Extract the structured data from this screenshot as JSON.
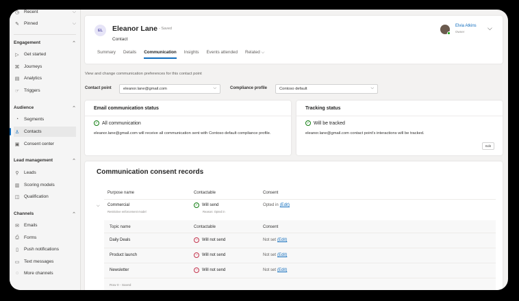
{
  "sidebar": {
    "top": [
      {
        "icon": "clock-icon",
        "label": "Recent"
      },
      {
        "icon": "pin-icon",
        "label": "Pinned"
      }
    ],
    "groups": [
      {
        "title": "Engagement",
        "items": [
          {
            "icon": "play-icon",
            "label": "Get started"
          },
          {
            "icon": "journey-icon",
            "label": "Journeys"
          },
          {
            "icon": "analytics-icon",
            "label": "Analytics"
          },
          {
            "icon": "trigger-icon",
            "label": "Triggers"
          }
        ]
      },
      {
        "title": "Audience",
        "items": [
          {
            "icon": "segment-icon",
            "label": "Segments"
          },
          {
            "icon": "contact-icon",
            "label": "Contacts"
          },
          {
            "icon": "consent-icon",
            "label": "Consent center"
          }
        ]
      },
      {
        "title": "Lead management",
        "items": [
          {
            "icon": "lead-icon",
            "label": "Leads"
          },
          {
            "icon": "scoring-icon",
            "label": "Scoring models"
          },
          {
            "icon": "qualification-icon",
            "label": "Qualification"
          }
        ]
      },
      {
        "title": "Channels",
        "items": [
          {
            "icon": "email-icon",
            "label": "Emails"
          },
          {
            "icon": "form-icon",
            "label": "Forms"
          },
          {
            "icon": "push-icon",
            "label": "Push notifications"
          },
          {
            "icon": "sms-icon",
            "label": "Text messages"
          },
          {
            "icon": "channels-icon",
            "label": "More channels"
          }
        ]
      }
    ],
    "active": "Contacts"
  },
  "record": {
    "initials": "EL",
    "name": "Eleanor Lane",
    "saved": "- Saved",
    "type": "Contact",
    "owner_name": "Elvia Atkins",
    "owner_role": "Owner",
    "tabs": [
      "Summary",
      "Details",
      "Communication",
      "Insights",
      "Events attended",
      "Related ⌵"
    ],
    "active_tab": "Communication"
  },
  "prefs": {
    "subtitle": "View and change communication preferences for this contact point",
    "contact_point_label": "Contact point",
    "contact_point_value": "eleanor.lane@gmail.com",
    "compliance_label": "Compliance profile",
    "compliance_value": "Contoso default"
  },
  "email_status": {
    "title": "Email communication status",
    "status": "All communication",
    "description": "eleanor.lane@gmail.com will receive all communication sent with Contoso default compliance profile."
  },
  "tracking": {
    "title": "Tracking status",
    "status": "Will be tracked",
    "description": "eleanor.lane@gmail.com contact point's interactions will be tracked.",
    "edit": "Edit"
  },
  "consent": {
    "title": "Communication consent records",
    "headers": [
      "Purpose name",
      "Contactable",
      "Consent"
    ],
    "purpose": {
      "name": "Commercial",
      "model": "Restrictive enforcement model",
      "contactable": "Will send",
      "reason": "Reason: Opted in",
      "consent": "Opted in",
      "edit": "(Edit)"
    },
    "topic_headers": [
      "Topic name",
      "Contactable",
      "Consent"
    ],
    "topics": [
      {
        "name": "Daily Deals",
        "contactable": "Will not send",
        "consent": "Not set",
        "edit": "(Edit)"
      },
      {
        "name": "Product launch",
        "contactable": "Will not send",
        "consent": "Not set",
        "edit": "(Edit)"
      },
      {
        "name": "Newsletter",
        "contactable": "Will not send",
        "consent": "Not set",
        "edit": "(Edit)"
      }
    ],
    "footer": "Row 0 - Saved"
  },
  "colors": {
    "accent": "#0f6cbd",
    "ok": "#107c10",
    "blocked": "#c4314b"
  }
}
